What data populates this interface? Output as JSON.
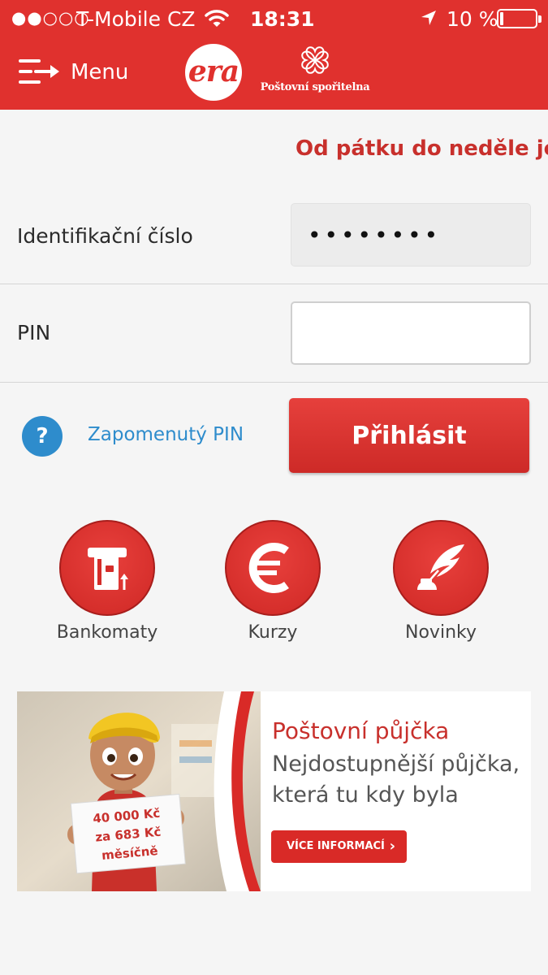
{
  "status_bar": {
    "signal": "●●○○○",
    "carrier": "T-Mobile CZ",
    "time": "18:31",
    "battery_percent": "10 %",
    "battery_level": 0.1
  },
  "nav": {
    "menu_label": "Menu",
    "era_logo": "era",
    "bank_name": "Poštovní spořitelna",
    "color": "#e0312e"
  },
  "marquee": {
    "text": "Od pátku do neděle je m"
  },
  "login_form": {
    "id_label": "Identifikační číslo",
    "id_value": "••••••••",
    "pin_label": "PIN",
    "pin_value": "",
    "help_symbol": "?",
    "forgot_pin": "Zapomenutý PIN",
    "login_button": "Přihlásit"
  },
  "quick_links": [
    {
      "label": "Bankomaty",
      "icon": "atm-icon"
    },
    {
      "label": "Kurzy",
      "icon": "euro-icon"
    },
    {
      "label": "Novinky",
      "icon": "quill-icon"
    }
  ],
  "banner": {
    "title": "Poštovní půjčka",
    "subtitle_line1": "Nejdostupnější půjčka,",
    "subtitle_line2": "která tu kdy byla",
    "button": "VÍCE INFORMACÍ",
    "sign_line1": "40 000 Kč",
    "sign_line2": "za 683 Kč",
    "sign_line3": "měsíčně"
  }
}
